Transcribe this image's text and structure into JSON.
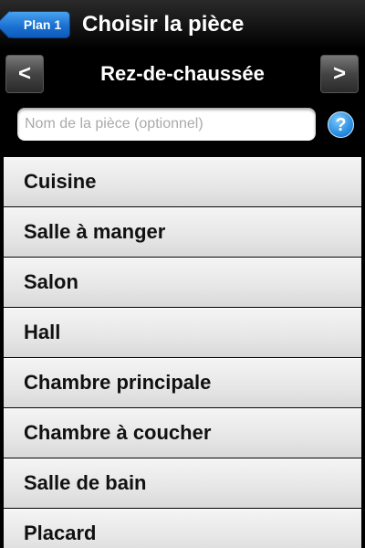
{
  "navbar": {
    "back_label": "Plan 1",
    "title": "Choisir la pièce"
  },
  "floor_selector": {
    "prev_label": "<",
    "current_floor": "Rez-de-chaussée",
    "next_label": ">"
  },
  "room_name_field": {
    "value": "",
    "placeholder": "Nom de la pièce (optionnel)"
  },
  "help": {
    "label": "?"
  },
  "rooms": [
    "Cuisine",
    "Salle à manger",
    "Salon",
    "Hall",
    "Chambre principale",
    "Chambre à coucher",
    "Salle de bain",
    "Placard"
  ],
  "colors": {
    "accent_blue": "#1a6fd0",
    "navbar_background": "#111111",
    "list_item_background": "#e6e6e6"
  }
}
